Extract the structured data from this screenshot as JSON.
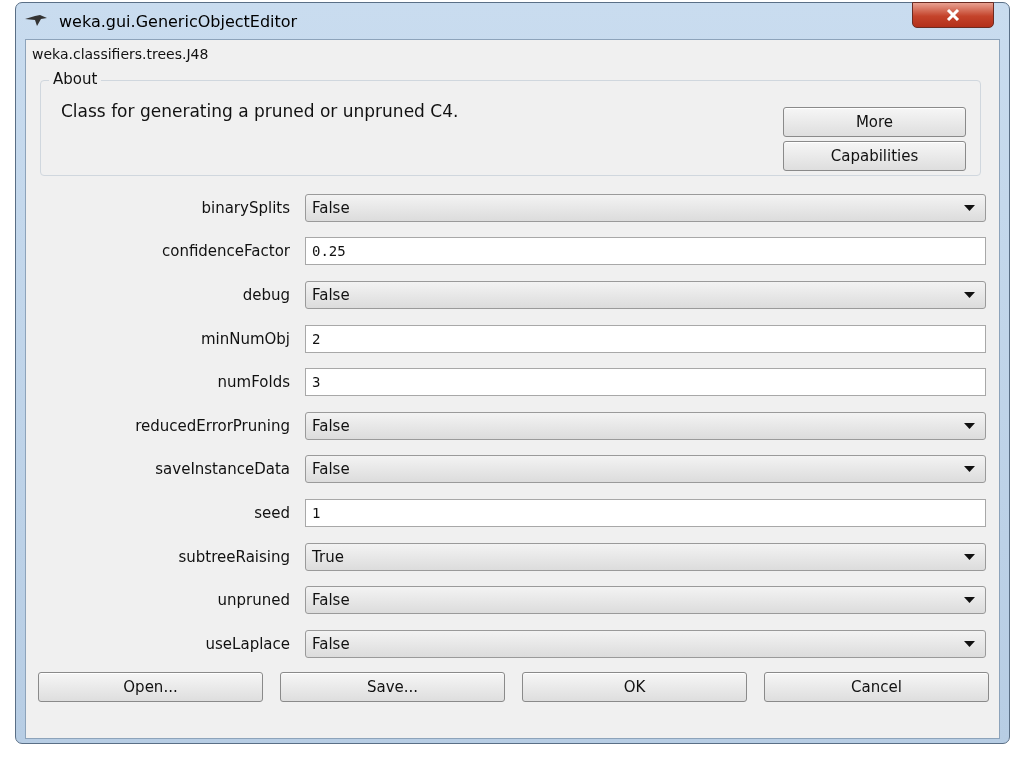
{
  "window": {
    "title": "weka.gui.GenericObjectEditor"
  },
  "class_name": "weka.classifiers.trees.J48",
  "about": {
    "heading": "About",
    "description": "Class for generating a pruned or unpruned C4.",
    "buttons": [
      "More",
      "Capabilities"
    ]
  },
  "properties": [
    {
      "name": "binarySplits",
      "kind": "dropdown",
      "value": "False"
    },
    {
      "name": "confidenceFactor",
      "kind": "text",
      "value": "0.25"
    },
    {
      "name": "debug",
      "kind": "dropdown",
      "value": "False"
    },
    {
      "name": "minNumObj",
      "kind": "text",
      "value": "2"
    },
    {
      "name": "numFolds",
      "kind": "text",
      "value": "3"
    },
    {
      "name": "reducedErrorPruning",
      "kind": "dropdown",
      "value": "False"
    },
    {
      "name": "saveInstanceData",
      "kind": "dropdown",
      "value": "False"
    },
    {
      "name": "seed",
      "kind": "text",
      "value": "1"
    },
    {
      "name": "subtreeRaising",
      "kind": "dropdown",
      "value": "True"
    },
    {
      "name": "unpruned",
      "kind": "dropdown",
      "value": "False"
    },
    {
      "name": "useLaplace",
      "kind": "dropdown",
      "value": "False"
    }
  ],
  "buttons": [
    "Open...",
    "Save...",
    "OK",
    "Cancel"
  ]
}
